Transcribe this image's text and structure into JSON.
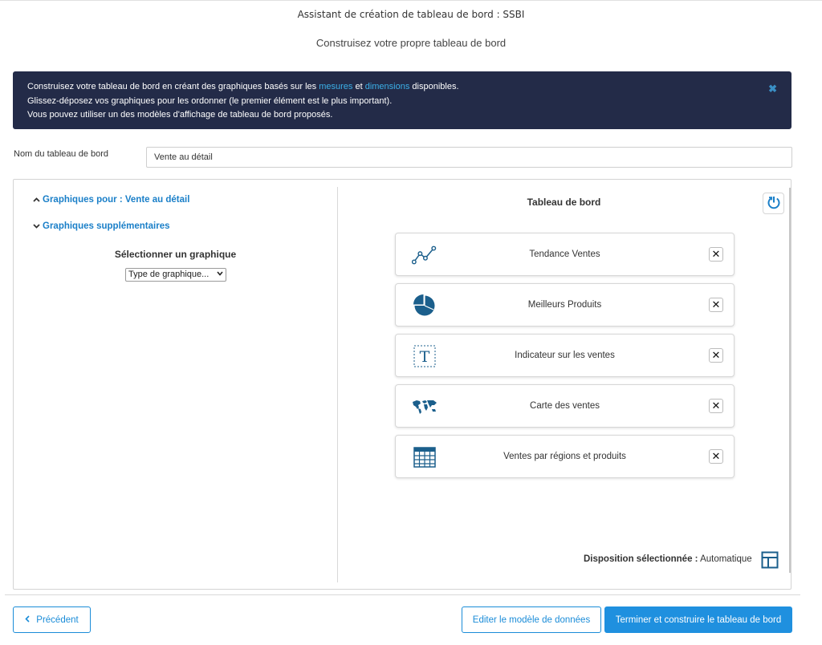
{
  "header": {
    "title": "Assistant de création de tableau de bord : SSBI",
    "subtitle": "Construisez votre propre tableau de bord"
  },
  "banner": {
    "line1_a": "Construisez votre tableau de bord en créant des graphiques basés sur les ",
    "line1_link1": "mesures",
    "line1_b": " et ",
    "line1_link2": "dimensions",
    "line1_c": " disponibles.",
    "line2": "Glissez-déposez vos graphiques pour les ordonner (le premier élément est le plus important).",
    "line3": "Vous pouvez utiliser un des modèles d'affichage de tableau de bord proposés.",
    "close_icon": "close-icon"
  },
  "dashboard_name": {
    "label": "Nom du tableau de bord",
    "value": "Vente au détail"
  },
  "left_panel": {
    "section1": "Graphiques pour : Vente au détail",
    "section2": "Graphiques supplémentaires",
    "select_label": "Sélectionner un graphique",
    "select_value": "Type de graphique..."
  },
  "right_panel": {
    "title": "Tableau de bord",
    "cards": [
      {
        "label": "Tendance Ventes",
        "icon": "line-chart-icon"
      },
      {
        "label": "Meilleurs Produits",
        "icon": "pie-chart-icon"
      },
      {
        "label": "Indicateur sur les ventes",
        "icon": "text-indicator-icon"
      },
      {
        "label": "Carte des ventes",
        "icon": "world-map-icon"
      },
      {
        "label": "Ventes par régions et produits",
        "icon": "table-icon"
      }
    ],
    "layout_label": "Disposition sélectionnée :",
    "layout_value": "Automatique"
  },
  "footer": {
    "prev": "Précédent",
    "edit_model": "Editer le modèle de données",
    "finish": "Terminer et construire le tableau de bord"
  },
  "colors": {
    "accent": "#1f90df",
    "banner_bg": "#232b48",
    "link": "#1a7fc8"
  }
}
